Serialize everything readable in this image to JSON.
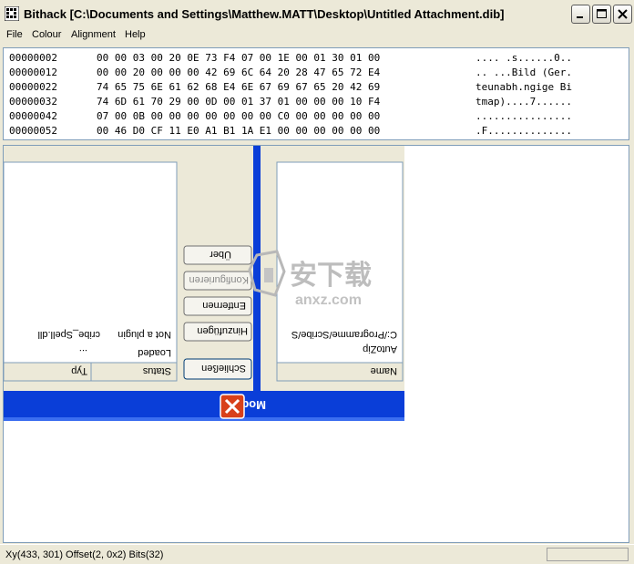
{
  "window": {
    "title": "Bithack [C:\\Documents and Settings\\Matthew.MATT\\Desktop\\Untitled Attachment.dib]"
  },
  "menu": [
    {
      "label": "File"
    },
    {
      "label": "Colour"
    },
    {
      "label": "Alignment"
    },
    {
      "label": "Help"
    }
  ],
  "hex": {
    "rows": [
      {
        "offset": "00000002",
        "bytes": "00 00 03 00 20 0E 73 F4 07 00 1E 00 01 30 01 00",
        "ascii": ".... .s......0.."
      },
      {
        "offset": "00000012",
        "bytes": "00 00 20 00 00 00 42 69 6C 64 20 28 47 65 72 E4",
        "ascii": ".. ...Bild (Ger."
      },
      {
        "offset": "00000022",
        "bytes": "74 65 75 6E 61 62 68 E4 6E 67 69 67 65 20 42 69",
        "ascii": "teunabh.ngige Bi"
      },
      {
        "offset": "00000032",
        "bytes": "74 6D 61 70 29 00 0D 00 01 37 01 00 00 00 10 F4",
        "ascii": "tmap)....7......"
      },
      {
        "offset": "00000042",
        "bytes": "07 00 0B 00 00 00 00 00 00 00 C0 00 00 00 00 00",
        "ascii": "................"
      },
      {
        "offset": "00000052",
        "bytes": "00 46 D0 CF 11 E0 A1 B1 1A E1 00 00 00 00 00 00",
        "ascii": ".F.............."
      }
    ]
  },
  "dialog": {
    "title": "Module",
    "buttons": {
      "about": "Über",
      "configure": "Konfigurieren",
      "remove": "Entfernen",
      "add": "Hinzufügen",
      "close": "Schließen"
    },
    "left_list": {
      "headers": [
        "Typ",
        "Status"
      ],
      "rows": [
        [
          "...",
          "Loaded"
        ],
        [
          "cribe_Spell.dll",
          "Not a plugin"
        ]
      ]
    },
    "right_list": {
      "header": "Name",
      "rows": [
        "AutoZip",
        "C:/Programme/Scribe/S"
      ]
    }
  },
  "watermark": {
    "chinese": "安下载",
    "latin": "anxz.com"
  },
  "status": {
    "text": "Xy(433, 301) Offset(2, 0x2) Bits(32)"
  },
  "colors": {
    "xp_blue": "#0a3ed8",
    "dialog_bg": "#ece9d8",
    "close_red": "#d8401a"
  }
}
